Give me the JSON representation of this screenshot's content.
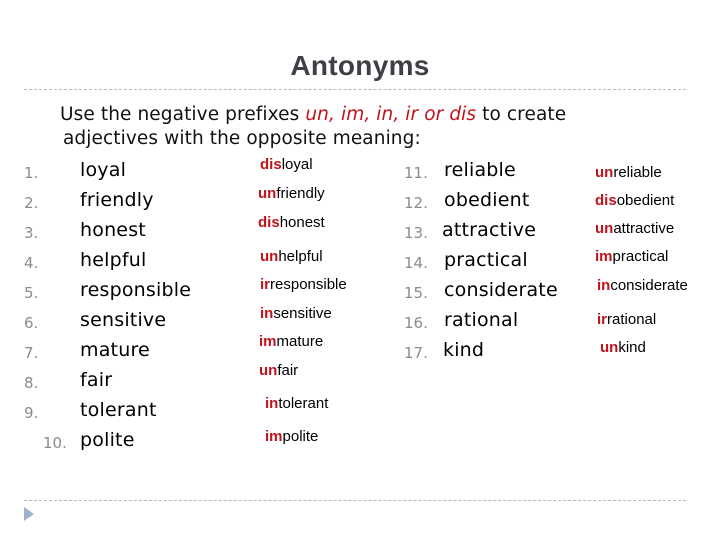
{
  "slide": {
    "title": "Antonyms",
    "intro": {
      "before": "Use the negative prefixes ",
      "prefixes": "un, im, in, ir or dis",
      "after": " to create",
      "line2": "adjectives with the opposite meaning:"
    },
    "colors": {
      "prefix_red": "#c0141c",
      "title_gray": "#3f3f46",
      "number_gray": "#8b8b8b",
      "nav_arrow": "#9fb3cc"
    },
    "left_items": [
      {
        "num": "1.",
        "word": "loyal",
        "prefix": "dis",
        "stem": "loyal"
      },
      {
        "num": "2.",
        "word": "friendly",
        "prefix": "un",
        "stem": "friendly"
      },
      {
        "num": "3.",
        "word": "honest",
        "prefix": "dis",
        "stem": "honest"
      },
      {
        "num": "4.",
        "word": "helpful",
        "prefix": "un",
        "stem": "helpful"
      },
      {
        "num": "5.",
        "word": "responsible",
        "prefix": "ir",
        "stem": "responsible"
      },
      {
        "num": "6.",
        "word": "sensitive",
        "prefix": "in",
        "stem": "sensitive"
      },
      {
        "num": "7.",
        "word": "mature",
        "prefix": "im",
        "stem": "mature"
      },
      {
        "num": "8.",
        "word": "fair",
        "prefix": "un",
        "stem": "fair"
      },
      {
        "num": "9.",
        "word": "tolerant",
        "prefix": "in",
        "stem": "tolerant"
      },
      {
        "num": "10.",
        "word": "polite",
        "prefix": "im",
        "stem": "polite"
      }
    ],
    "right_items": [
      {
        "num": "11.",
        "word": "reliable",
        "prefix": "un",
        "stem": "reliable"
      },
      {
        "num": "12.",
        "word": "obedient",
        "prefix": "dis",
        "stem": "obedient"
      },
      {
        "num": "13.",
        "word": "attractive",
        "prefix": "un",
        "stem": "attractive"
      },
      {
        "num": "14.",
        "word": "practical",
        "prefix": "im",
        "stem": "practical"
      },
      {
        "num": "15.",
        "word": "considerate",
        "prefix": "in",
        "stem": "considerate"
      },
      {
        "num": "16.",
        "word": "rational",
        "prefix": "ir",
        "stem": "rational"
      },
      {
        "num": "17.",
        "word": "kind",
        "prefix": "un",
        "stem": "kind"
      }
    ],
    "nav_icon": "play-triangle-icon"
  }
}
